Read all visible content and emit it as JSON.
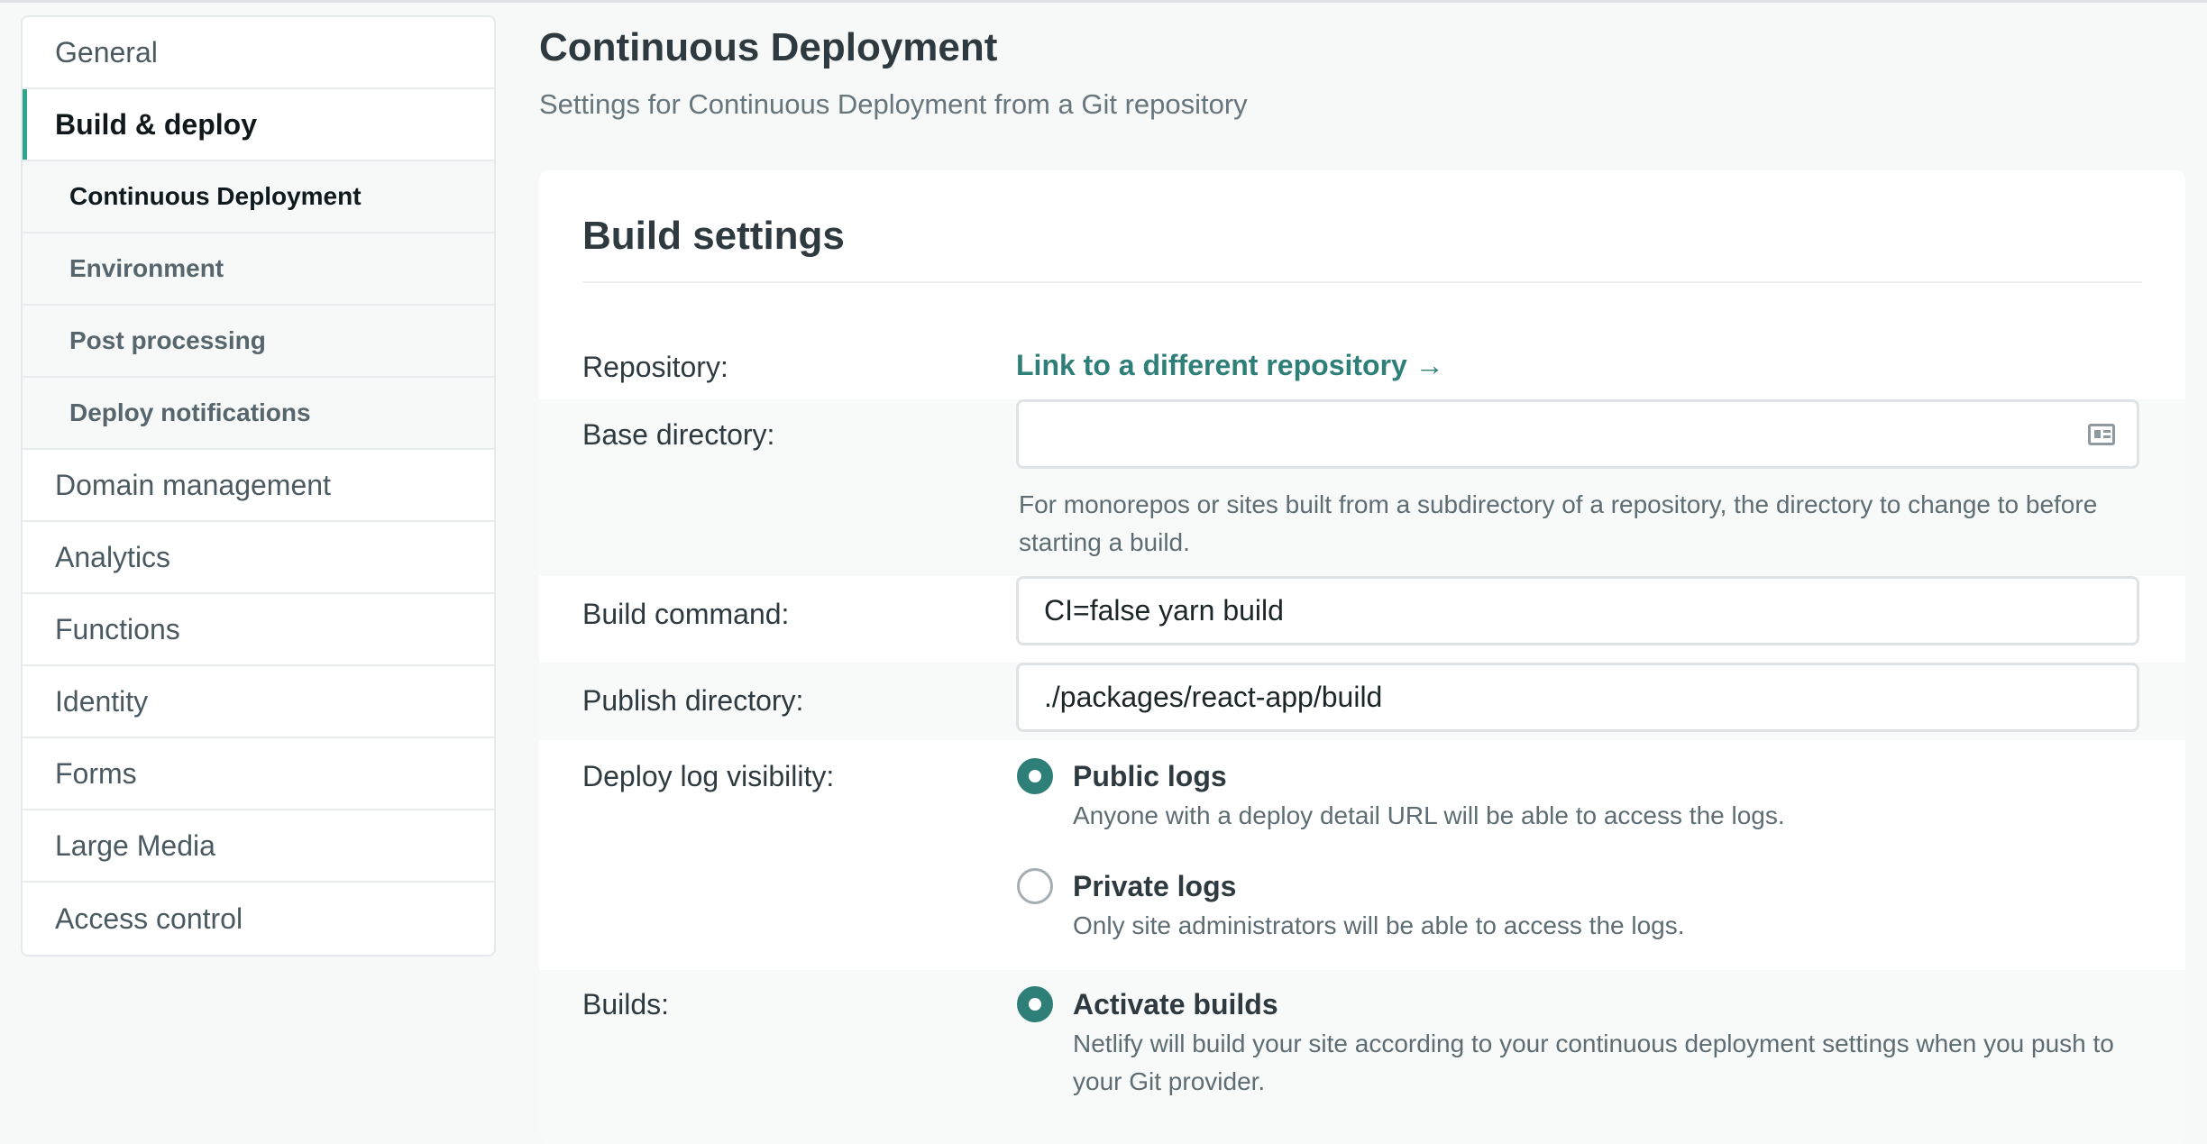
{
  "sidebar": {
    "items": [
      {
        "label": "General"
      },
      {
        "label": "Build & deploy"
      },
      {
        "label": "Domain management"
      },
      {
        "label": "Analytics"
      },
      {
        "label": "Functions"
      },
      {
        "label": "Identity"
      },
      {
        "label": "Forms"
      },
      {
        "label": "Large Media"
      },
      {
        "label": "Access control"
      }
    ],
    "subitems": [
      {
        "label": "Continuous Deployment"
      },
      {
        "label": "Environment"
      },
      {
        "label": "Post processing"
      },
      {
        "label": "Deploy notifications"
      }
    ]
  },
  "header": {
    "title": "Continuous Deployment",
    "subtitle": "Settings for Continuous Deployment from a Git repository"
  },
  "card": {
    "title": "Build settings",
    "repository": {
      "label": "Repository:",
      "link": "Link to a different repository →"
    },
    "base_directory": {
      "label": "Base directory:",
      "value": "",
      "help": "For monorepos or sites built from a subdirectory of a repository, the directory to change to before starting a build."
    },
    "build_command": {
      "label": "Build command:",
      "value": "CI=false yarn build"
    },
    "publish_directory": {
      "label": "Publish directory:",
      "value": "./packages/react-app/build"
    },
    "deploy_log_visibility": {
      "label": "Deploy log visibility:",
      "options": [
        {
          "label": "Public logs",
          "description": "Anyone with a deploy detail URL will be able to access the logs.",
          "checked": true
        },
        {
          "label": "Private logs",
          "description": "Only site administrators will be able to access the logs.",
          "checked": false
        }
      ]
    },
    "builds": {
      "label": "Builds:",
      "options": [
        {
          "label": "Activate builds",
          "description": "Netlify will build your site according to your continuous deployment settings when you push to your Git provider.",
          "checked": true
        }
      ]
    }
  },
  "colors": {
    "accent": "#2f7f79",
    "active_bar": "#30a58b"
  }
}
